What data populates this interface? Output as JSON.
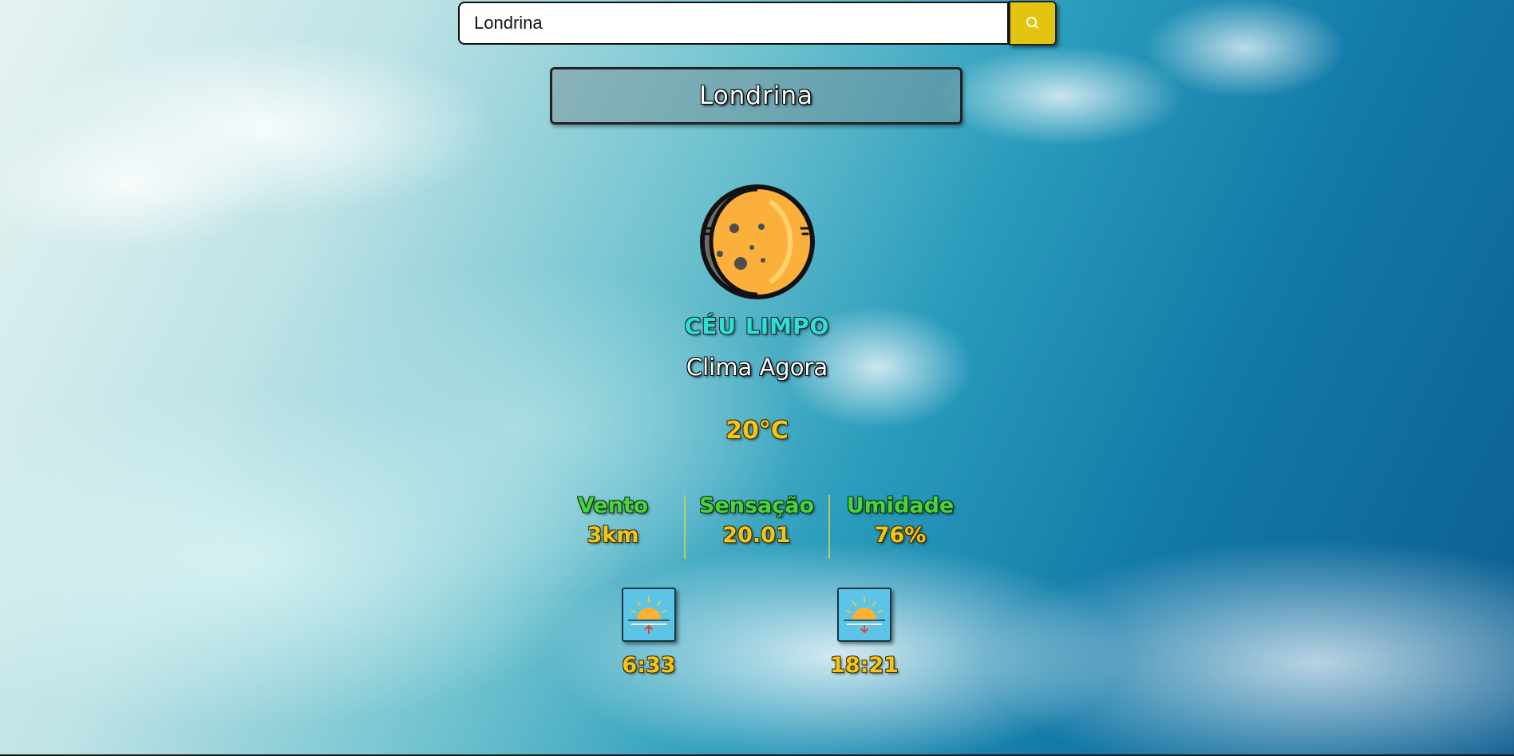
{
  "search": {
    "value": "Londrina",
    "placeholder": ""
  },
  "city": {
    "name": "Londrina"
  },
  "weather": {
    "icon": "crescent-moon-icon",
    "description": "CÉU LIMPO",
    "subtitle": "Clima Agora",
    "temperature": "20°C"
  },
  "stats": [
    {
      "label": "Vento",
      "value": "3km"
    },
    {
      "label": "Sensação",
      "value": "20.01"
    },
    {
      "label": "Umidade",
      "value": "76%"
    }
  ],
  "sun": {
    "sunrise": {
      "icon": "sunrise-icon",
      "time": "6:33"
    },
    "sunset": {
      "icon": "sunset-icon",
      "time": "18:21"
    }
  },
  "colors": {
    "search_button": "#e3c410",
    "description": "#2ee0d4",
    "stat_label": "#4ad43c",
    "value": "#f2c51c"
  }
}
